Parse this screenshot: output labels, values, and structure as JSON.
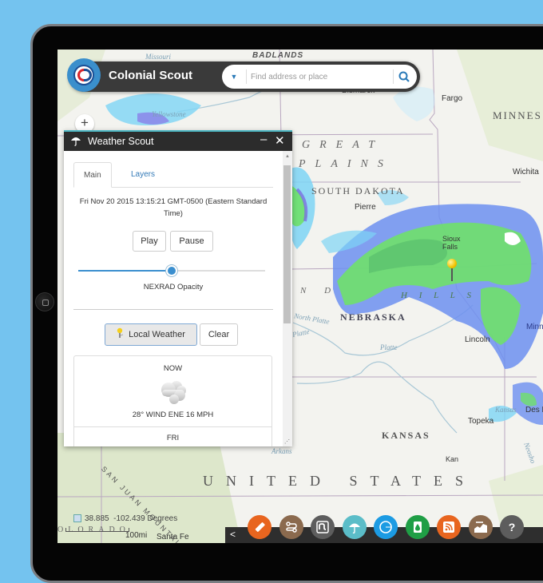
{
  "app": {
    "title": "Colonial Scout",
    "search": {
      "placeholder": "Find address or place"
    }
  },
  "map": {
    "zoom_in_label": "+",
    "labels": {
      "states": [
        "SOUTH DAKOTA",
        "NEBRASKA",
        "KANSAS",
        "MINNES",
        "OLORADO"
      ],
      "regions": [
        "GREAT",
        "PLAINS",
        "N D",
        "H I L L S",
        "BADLANDS",
        "SAN JUAN MOUNTAIN"
      ],
      "country": "UNITED STATES",
      "cities": [
        "Bismarck",
        "Fargo",
        "Pierre",
        "Sioux Falls",
        "Lincoln",
        "Topeka",
        "Wichita",
        "Minnea",
        "Des Moin",
        "Kan",
        "Santa Fe"
      ],
      "rivers": [
        "Missouri",
        "Yellowstone",
        "North Platte",
        "Platte",
        "Platte",
        "Kansas",
        "Neosho",
        "Arkans"
      ]
    },
    "coordinates": {
      "lat": "38.885",
      "lon": "-102.439",
      "unit": "Degrees"
    },
    "scale_label": "100mi"
  },
  "widget": {
    "title": "Weather Scout",
    "minimize_label": "–",
    "close_label": "✕",
    "tabs": [
      {
        "label": "Main",
        "active": true
      },
      {
        "label": "Layers",
        "active": false
      }
    ],
    "datetime": "Fri Nov 20 2015 13:15:21 GMT-0500 (Eastern Standard Time)",
    "play_label": "Play",
    "pause_label": "Pause",
    "opacity_value": 0.5,
    "opacity_label": "NEXRAD Opacity",
    "local_weather_label": "Local Weather",
    "clear_label": "Clear",
    "forecast": [
      {
        "period": "NOW",
        "icon": "cloudy-icon",
        "conditions": "28° WIND ENE 16 MPH"
      },
      {
        "period": "FRI"
      }
    ]
  },
  "toolbar": {
    "collapse_label": "<",
    "tools": [
      {
        "name": "measure-tool",
        "icon": "ruler-icon",
        "color": "#e8651f"
      },
      {
        "name": "directions-tool",
        "icon": "route-icon",
        "color": "#8b6a4e"
      },
      {
        "name": "stumbleupon-tool",
        "icon": "stumbleupon-icon",
        "color": "#5d5d5d"
      },
      {
        "name": "weather-tool",
        "icon": "umbrella-icon",
        "color": "#5bbdc8"
      },
      {
        "name": "draw-tool",
        "icon": "circle-icon",
        "color": "#1c9be3"
      },
      {
        "name": "oil-tool",
        "icon": "oil-barrel-icon",
        "color": "#1f9e45"
      },
      {
        "name": "rss-tool",
        "icon": "rss-icon",
        "color": "#e8651f"
      },
      {
        "name": "elevation-profile-tool",
        "icon": "profile-icon",
        "color": "#8b6a4e"
      },
      {
        "name": "help-tool",
        "icon": "help-icon",
        "color": "#5d5d5d"
      }
    ]
  }
}
